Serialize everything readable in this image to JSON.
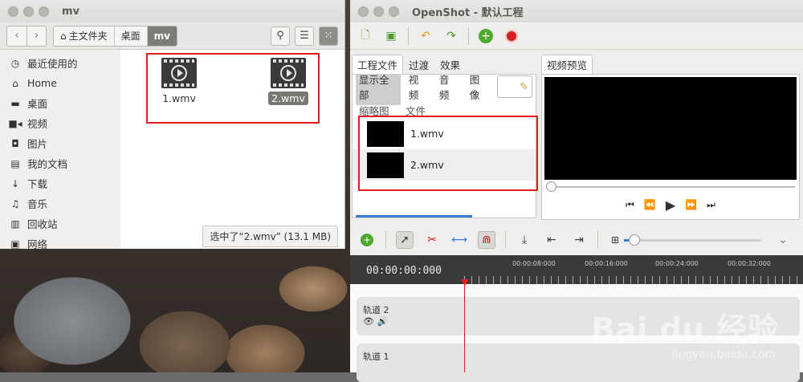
{
  "file_manager": {
    "window_title": "mv",
    "breadcrumbs": [
      {
        "label": "主文件夹"
      },
      {
        "label": "桌面"
      },
      {
        "label": "mv"
      }
    ],
    "sidebar": [
      {
        "label": "最近使用的",
        "icon": "clock-icon"
      },
      {
        "label": "Home",
        "icon": "home-icon"
      },
      {
        "label": "桌面",
        "icon": "folder-icon"
      },
      {
        "label": "视频",
        "icon": "video-camera-icon"
      },
      {
        "label": "图片",
        "icon": "camera-icon"
      },
      {
        "label": "我的文档",
        "icon": "document-icon"
      },
      {
        "label": "下载",
        "icon": "download-icon"
      },
      {
        "label": "音乐",
        "icon": "music-icon"
      },
      {
        "label": "回收站",
        "icon": "trash-icon"
      },
      {
        "label": "网络",
        "icon": "network-icon"
      }
    ],
    "files": [
      {
        "name": "1.wmv",
        "selected": false
      },
      {
        "name": "2.wmv",
        "selected": true
      }
    ],
    "status": "选中了“2.wmv” (13.1 MB)"
  },
  "openshot": {
    "window_title": "OpenShot - 默认工程",
    "tabs": [
      "工程文件",
      "过渡",
      "效果"
    ],
    "preview_tab": "视频预览",
    "filters": [
      "显示全部",
      "视频",
      "音频",
      "图像"
    ],
    "columns": [
      "缩略图",
      "文件"
    ],
    "files": [
      {
        "name": "1.wmv"
      },
      {
        "name": "2.wmv"
      }
    ],
    "timecode": "00:00:00:000",
    "ruler_labels": [
      "00:00:08:000",
      "00:00:16:000",
      "00:00:24:000",
      "00:00:32:000"
    ],
    "tracks": [
      {
        "label": "轨道 2"
      },
      {
        "label": "轨道 1"
      }
    ]
  },
  "watermark": {
    "brand": "Bai du 经验",
    "url": "jingyan.baidu.com"
  },
  "colors": {
    "highlight_red": "#e01e1e",
    "accent_blue": "#3a7bd5"
  }
}
